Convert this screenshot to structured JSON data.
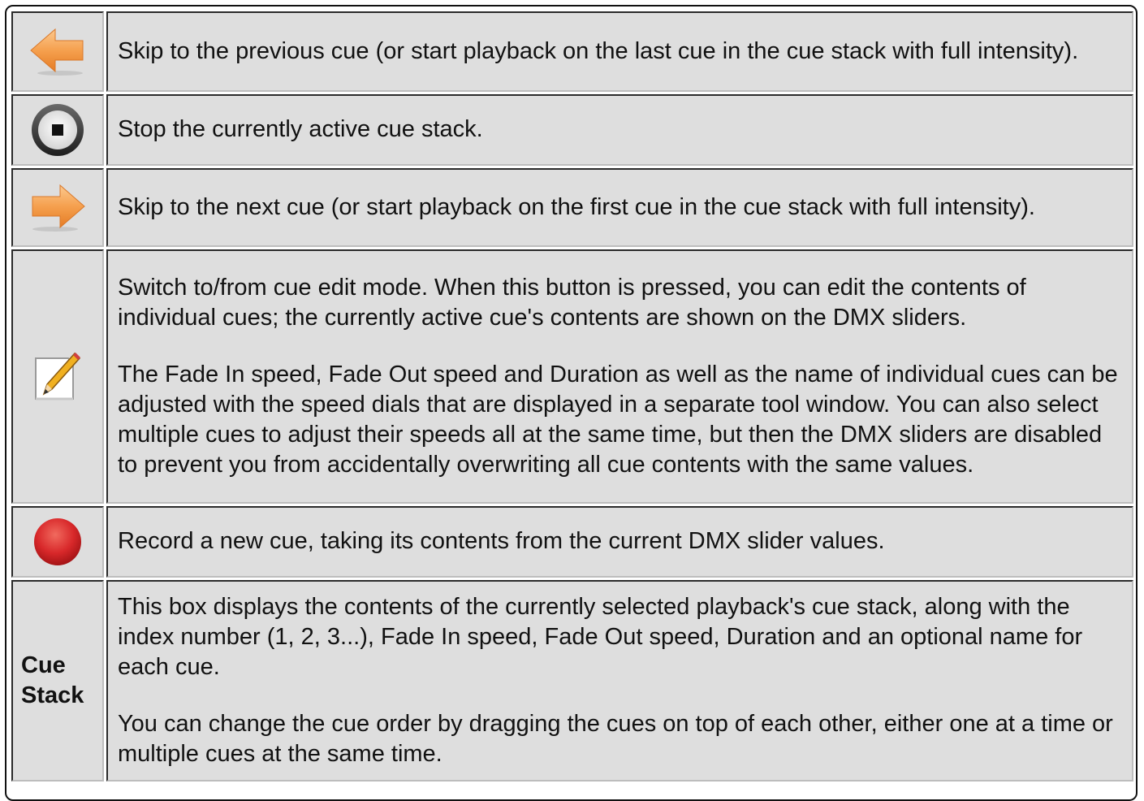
{
  "rows": [
    {
      "icon": "previous-arrow-icon",
      "text": "Skip to the previous cue (or start playback on the last cue in the cue stack with full intensity)."
    },
    {
      "icon": "stop-icon",
      "text": "Stop the currently active cue stack."
    },
    {
      "icon": "next-arrow-icon",
      "text": "Skip to the next cue (or start playback on the first cue in the cue stack with full intensity)."
    },
    {
      "icon": "edit-pencil-icon",
      "paragraphs": [
        "Switch to/from cue edit mode. When this button is pressed, you can edit the contents of individual cues; the currently active cue's contents are shown on the DMX sliders.",
        "The Fade In speed, Fade Out speed and Duration as well as the name of individual cues can be adjusted with the speed dials that are displayed in a separate tool window. You can also select multiple cues to adjust their speeds all at the same time, but then the DMX sliders are disabled to prevent you from accidentally overwriting all cue contents with the same values."
      ]
    },
    {
      "icon": "record-icon",
      "text": "Record a new cue, taking its contents from the current DMX slider values."
    },
    {
      "label_line1": "Cue",
      "label_line2": "Stack",
      "paragraphs": [
        "This box displays the contents of the currently selected playback's cue stack, along with the index number (1, 2, 3...), Fade In speed, Fade Out speed, Duration and an optional name for each cue.",
        "You can change the cue order by dragging the cues on top of each other, either one at a time or multiple cues at the same time."
      ]
    }
  ],
  "colors": {
    "arrow_orange": "#f5a04e",
    "record_red": "#d8282a",
    "cell_background": "#dedede"
  }
}
